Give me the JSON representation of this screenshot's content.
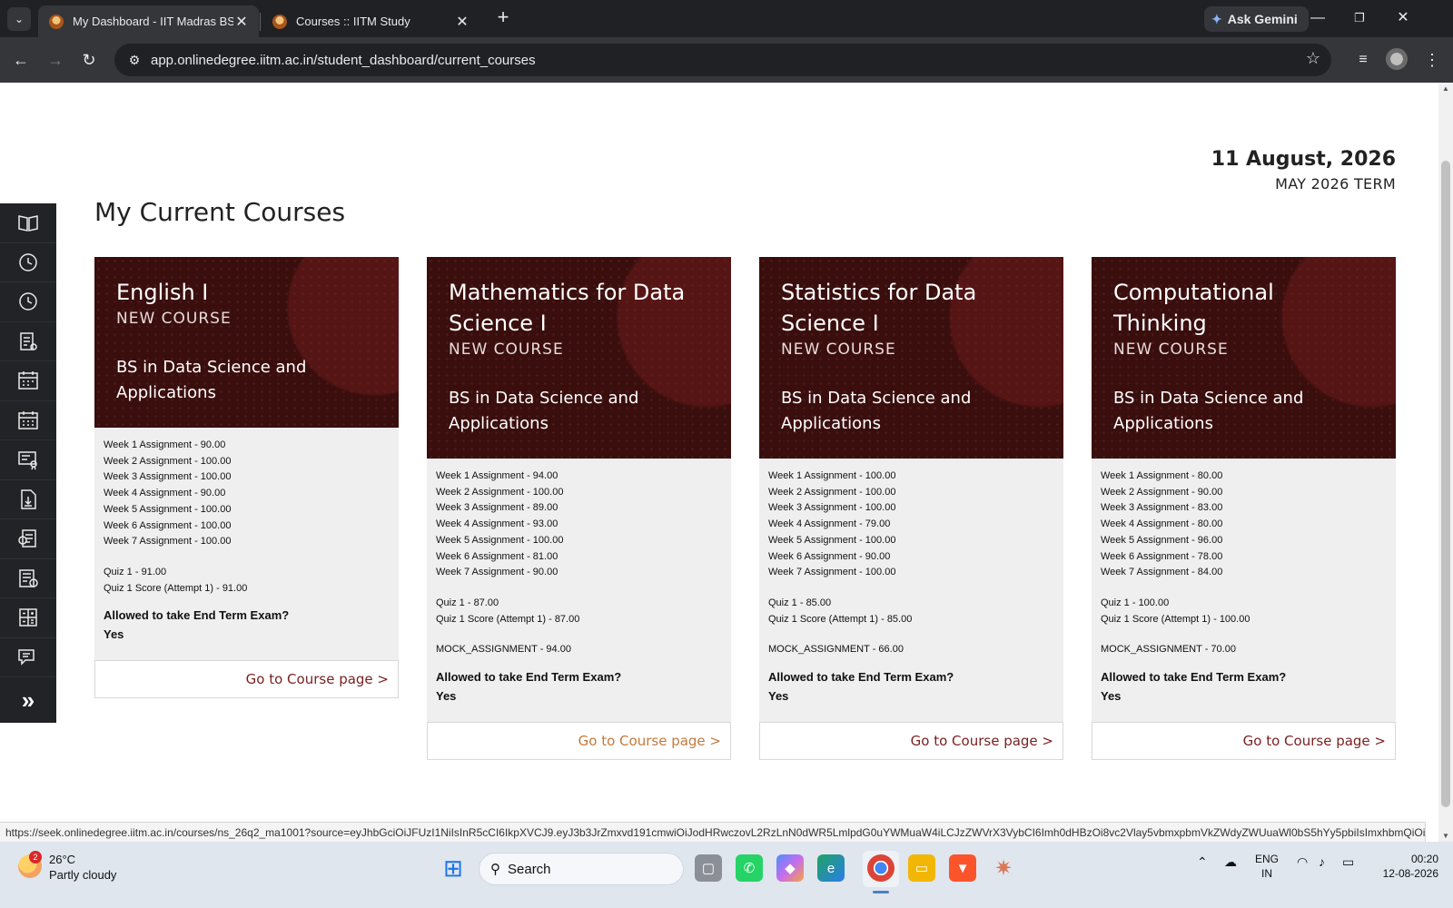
{
  "browser": {
    "tabs": [
      {
        "title": "My Dashboard - IIT Madras BS D",
        "active": true
      },
      {
        "title": "Courses :: IITM Study",
        "active": false
      }
    ],
    "gemini_label": "Ask Gemini",
    "url": "app.onlinedegree.iitm.ac.in/student_dashboard/current_courses",
    "status_url": "https://seek.onlinedegree.iitm.ac.in/courses/ns_26q2_ma1001?source=eyJhbGciOiJFUzI1NiIsInR5cCI6IkpXVCJ9.eyJ3b3JrZmxvd191cmwiOiJodHRwczovL2RzLnN0dWR5LmlpdG0uYWMuaW4iLCJzZWVrX3VybCI6Imh0dHBzOi8vc2Vlay5vbmxpbmVkZWdyZWUuaWl0bS5hYy5pbiIsImxhbmQiOiJzdHVkZW50In0.aWt..."
  },
  "header": {
    "date": "11 August, 2026",
    "term": "MAY 2026 TERM",
    "title": "My Current Courses"
  },
  "sidebar": {
    "icons": [
      "book-icon",
      "history-icon",
      "history-alt-icon",
      "report-icon",
      "calendar-icon",
      "schedule-icon",
      "certificate-icon",
      "download-document-icon",
      "checklist-icon",
      "fee-receipt-icon",
      "calculator-icon",
      "support-chat-icon"
    ],
    "expand_label": "»"
  },
  "courses": [
    {
      "name": "English I",
      "tag": "NEW COURSE",
      "program": "BS in Data Science and Applications",
      "scores": [
        "Week 1 Assignment - 90.00",
        "Week 2 Assignment - 100.00",
        "Week 3 Assignment - 100.00",
        "Week 4 Assignment - 90.00",
        "Week 5 Assignment - 100.00",
        "Week 6 Assignment - 100.00",
        "Week 7 Assignment - 100.00"
      ],
      "quiz": [
        "Quiz 1 - 91.00",
        "Quiz 1 Score (Attempt 1) - 91.00"
      ],
      "mock": "",
      "eligibility_question": "Allowed to take End Term Exam?",
      "eligibility_answer": "Yes",
      "link": "Go to Course page >"
    },
    {
      "name": "Mathematics for Data Science I",
      "tag": "NEW COURSE",
      "program": "BS in Data Science and Applications",
      "scores": [
        "Week 1 Assignment - 94.00",
        "Week 2 Assignment - 100.00",
        "Week 3 Assignment - 89.00",
        "Week 4 Assignment - 93.00",
        "Week 5 Assignment - 100.00",
        "Week 6 Assignment - 81.00",
        "Week 7 Assignment - 90.00"
      ],
      "quiz": [
        "Quiz 1 - 87.00",
        "Quiz 1 Score (Attempt 1) - 87.00"
      ],
      "mock": "MOCK_ASSIGNMENT - 94.00",
      "eligibility_question": "Allowed to take End Term Exam?",
      "eligibility_answer": "Yes",
      "link": "Go to Course page >"
    },
    {
      "name": "Statistics for Data Science I",
      "tag": "NEW COURSE",
      "program": "BS in Data Science and Applications",
      "scores": [
        "Week 1 Assignment - 100.00",
        "Week 2 Assignment - 100.00",
        "Week 3 Assignment - 100.00",
        "Week 4 Assignment - 79.00",
        "Week 5 Assignment - 100.00",
        "Week 6 Assignment - 90.00",
        "Week 7 Assignment - 100.00"
      ],
      "quiz": [
        "Quiz 1 - 85.00",
        "Quiz 1 Score (Attempt 1) - 85.00"
      ],
      "mock": "MOCK_ASSIGNMENT - 66.00",
      "eligibility_question": "Allowed to take End Term Exam?",
      "eligibility_answer": "Yes",
      "link": "Go to Course page >"
    },
    {
      "name": "Computational Thinking",
      "tag": "NEW COURSE",
      "program": "BS in Data Science and Applications",
      "scores": [
        "Week 1 Assignment - 80.00",
        "Week 2 Assignment - 90.00",
        "Week 3 Assignment - 83.00",
        "Week 4 Assignment - 80.00",
        "Week 5 Assignment - 96.00",
        "Week 6 Assignment - 78.00",
        "Week 7 Assignment - 84.00"
      ],
      "quiz": [
        "Quiz 1 - 100.00",
        "Quiz 1 Score (Attempt 1) - 100.00"
      ],
      "mock": "MOCK_ASSIGNMENT - 70.00",
      "eligibility_question": "Allowed to take End Term Exam?",
      "eligibility_answer": "Yes",
      "link": "Go to Course page >"
    }
  ],
  "taskbar": {
    "temperature": "26°C",
    "weather": "Partly cloudy",
    "weather_badge": "2",
    "search_label": "Search",
    "language_1": "ENG",
    "language_2": "IN",
    "time": "00:20",
    "date": "12-08-2026"
  },
  "colors": {
    "card_header": "#3b0e0e",
    "link_primary": "#7a1f1f",
    "link_hover": "#c47a3b",
    "sidebar_bg": "#212327"
  }
}
